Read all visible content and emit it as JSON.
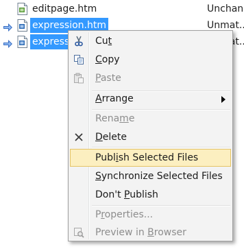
{
  "files": [
    {
      "name": "editpage.htm",
      "status": "Unchan...",
      "selected": false,
      "arrow": false
    },
    {
      "name": "expression.htm",
      "status": "Unmat...",
      "selected": true,
      "arrow": true
    },
    {
      "name": "expressi",
      "status": "Unmat...",
      "selected": true,
      "arrow": true
    }
  ],
  "menu": {
    "cut": {
      "pre": "Cu",
      "key": "t",
      "post": "",
      "icon": "scissors-icon"
    },
    "copy": {
      "pre": "",
      "key": "C",
      "post": "opy",
      "icon": "copy-icon"
    },
    "paste": {
      "pre": "",
      "key": "P",
      "post": "aste",
      "icon": "paste-icon",
      "disabled": true
    },
    "arrange": {
      "pre": "",
      "key": "A",
      "post": "rrange"
    },
    "rename": {
      "pre": "Rena",
      "key": "m",
      "post": "e",
      "disabled": true
    },
    "delete": {
      "pre": "",
      "key": "D",
      "post": "elete",
      "icon": "delete-x-icon"
    },
    "publish_selected": {
      "pre": "Publ",
      "key": "i",
      "post": "sh Selected Files"
    },
    "synchronize": {
      "pre": "",
      "key": "S",
      "post": "ynchronize Selected Files"
    },
    "dont_publish": {
      "pre": "Don't ",
      "key": "P",
      "post": "ublish"
    },
    "properties": {
      "pre": "P",
      "key": "r",
      "post": "operties...",
      "disabled": true
    },
    "preview": {
      "pre": "Preview in ",
      "key": "B",
      "post": "rowser",
      "icon": "preview-browser-icon",
      "disabled": true
    }
  },
  "colors": {
    "selection": "#3399ff",
    "highlight_bg": "#fcefc0",
    "highlight_border": "#e5c365",
    "disabled_text": "#8d8d8d"
  }
}
